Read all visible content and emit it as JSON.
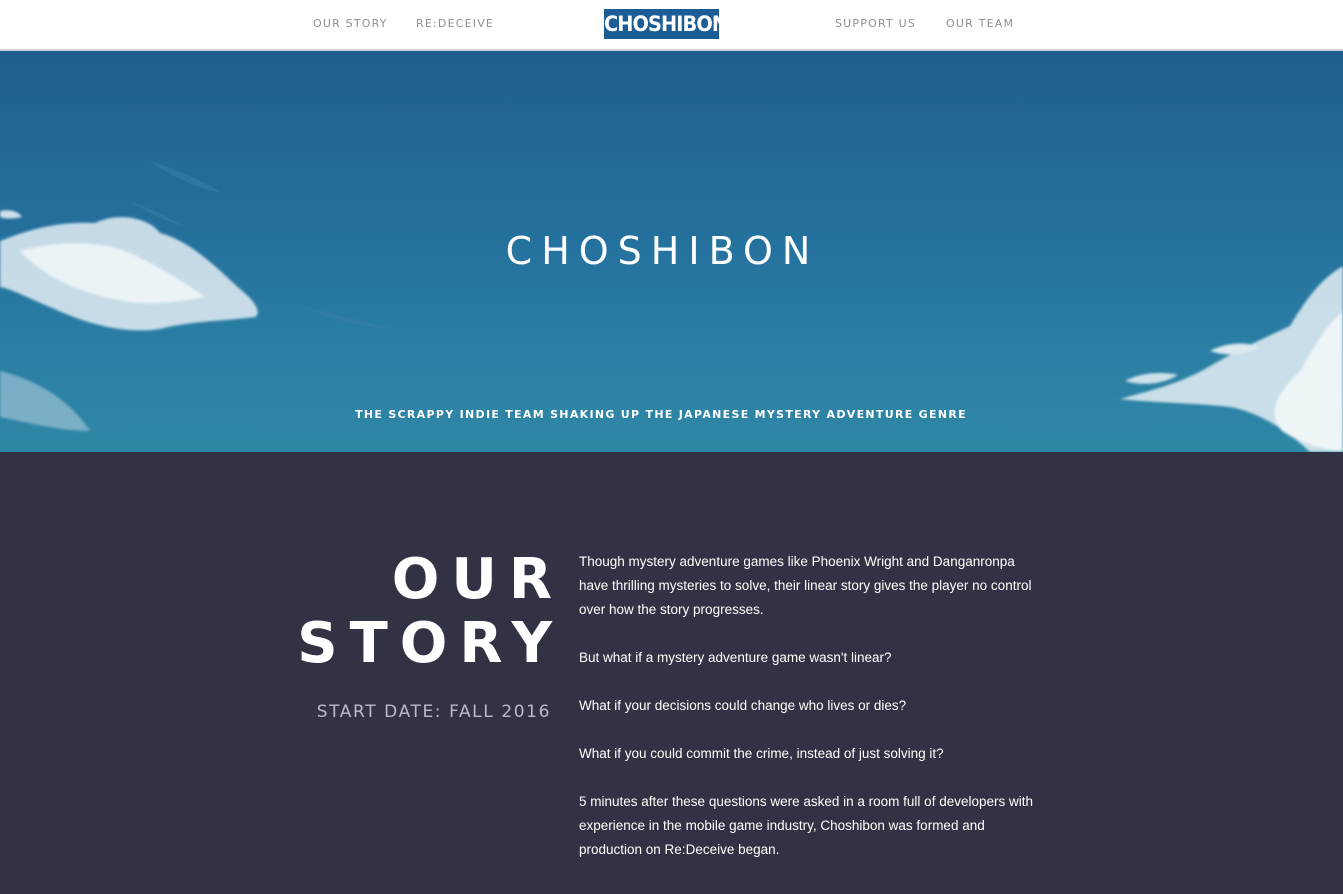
{
  "nav": {
    "left": [
      {
        "label": "OUR STORY"
      },
      {
        "label": "RE:DECEIVE"
      }
    ],
    "logo": "CHOSHIBON",
    "right": [
      {
        "label": "SUPPORT US"
      },
      {
        "label": "OUR TEAM"
      }
    ]
  },
  "hero": {
    "title": "CHOSHIBON",
    "tagline": "THE SCRAPPY INDIE TEAM SHAKING UP THE JAPANESE MYSTERY ADVENTURE GENRE"
  },
  "story": {
    "heading_line1": "OUR",
    "heading_line2": "STORY",
    "start_date": "START DATE: FALL 2016",
    "paragraphs": [
      "Though mystery adventure games like Phoenix Wright and Danganronpa have thrilling mysteries to solve, their linear story gives the player no control over how the story progresses.",
      "But what if a mystery adventure game wasn't linear?",
      "What if your decisions could change who lives or dies?",
      "What if you could commit the crime, instead of just solving it?",
      "5 minutes after these questions were asked in a room full of developers with experience in the mobile game industry, Choshibon was formed and production on Re:Deceive began."
    ]
  },
  "colors": {
    "nav_bg": "#ffffff",
    "logo_bg": "#1b5d95",
    "hero_sky": "#24709d",
    "section_bg": "#323245"
  }
}
